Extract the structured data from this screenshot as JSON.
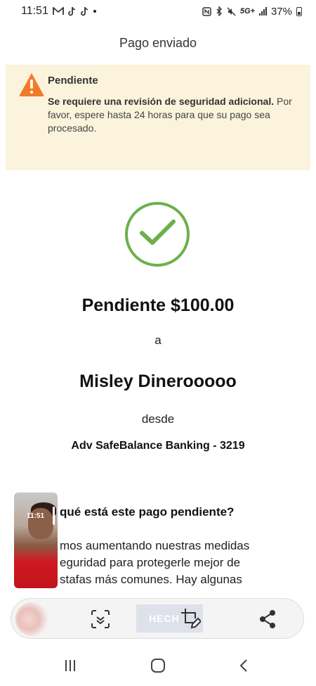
{
  "status_bar": {
    "time": "11:51",
    "network": "5G+",
    "battery": "37%",
    "left_icons": [
      "gmail-icon",
      "tiktok-icon",
      "tiktok-icon"
    ],
    "right_icons": [
      "nfc-icon",
      "bluetooth-icon",
      "mute-icon",
      "5g-icon",
      "signal-icon",
      "battery-icon"
    ]
  },
  "header": {
    "title": "Pago enviado"
  },
  "alert": {
    "title": "Pendiente",
    "bold_text": "Se requiere una revisión de seguridad adicional.",
    "text": " Por favor, espere hasta 24 horas para que su pago sea procesado.",
    "color": "#fbf3dc",
    "icon_color": "#f07c2a"
  },
  "status_icon": {
    "name": "check-circle-icon",
    "color": "#6cb04a"
  },
  "payment": {
    "amount_line": "Pendiente $100.00",
    "to_word": "a",
    "recipient": "Misley Dinerooooo",
    "from_word": "desde",
    "account": "Adv SafeBalance Banking - 3219"
  },
  "info": {
    "title": "qué está este pago pendiente?",
    "lines": [
      "mos aumentando nuestras medidas",
      "eguridad para protegerle mejor de",
      "stafas más comunes. Hay algunas"
    ]
  },
  "pip": {
    "time": "11:51"
  },
  "toolbar": {
    "done_label": "HECH"
  },
  "navbar": {
    "items": [
      "recents-icon",
      "home-icon",
      "back-icon"
    ]
  }
}
